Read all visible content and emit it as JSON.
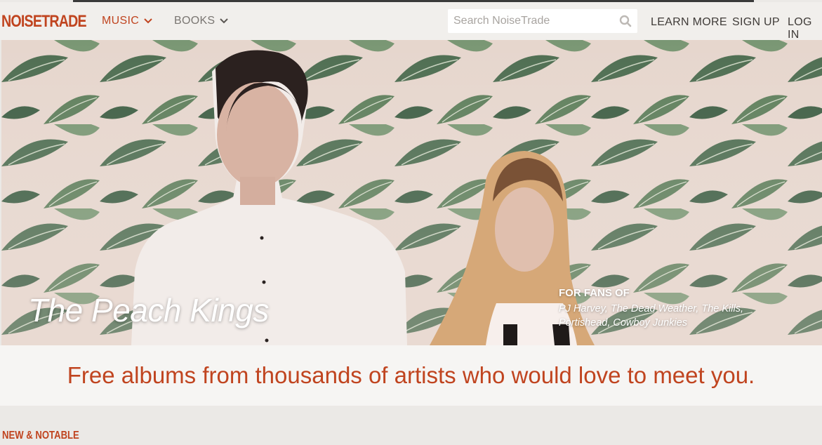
{
  "header": {
    "logo": "NOISETRADE",
    "nav": [
      {
        "label": "MUSIC",
        "active": true
      },
      {
        "label": "BOOKS",
        "active": false
      }
    ],
    "search": {
      "placeholder": "Search NoiseTrade",
      "value": ""
    },
    "links": {
      "learn_more": "LEARN MORE",
      "sign_up": "SIGN UP",
      "log_in": "LOG IN"
    }
  },
  "hero": {
    "artist": "The Peach Kings",
    "fans_label": "FOR FANS OF",
    "fans_list": "PJ Harvey, The Dead Weather, The Kills, Portishead, Cowboy Junkies"
  },
  "tagline": "Free albums from thousands of artists who would love to meet you.",
  "section": {
    "title": "NEW & NOTABLE"
  },
  "colors": {
    "brand": "#c0441f",
    "nav_bg": "#f1efec",
    "page_bg": "#ebe9e6",
    "tagline_bg": "#f6f5f3"
  }
}
